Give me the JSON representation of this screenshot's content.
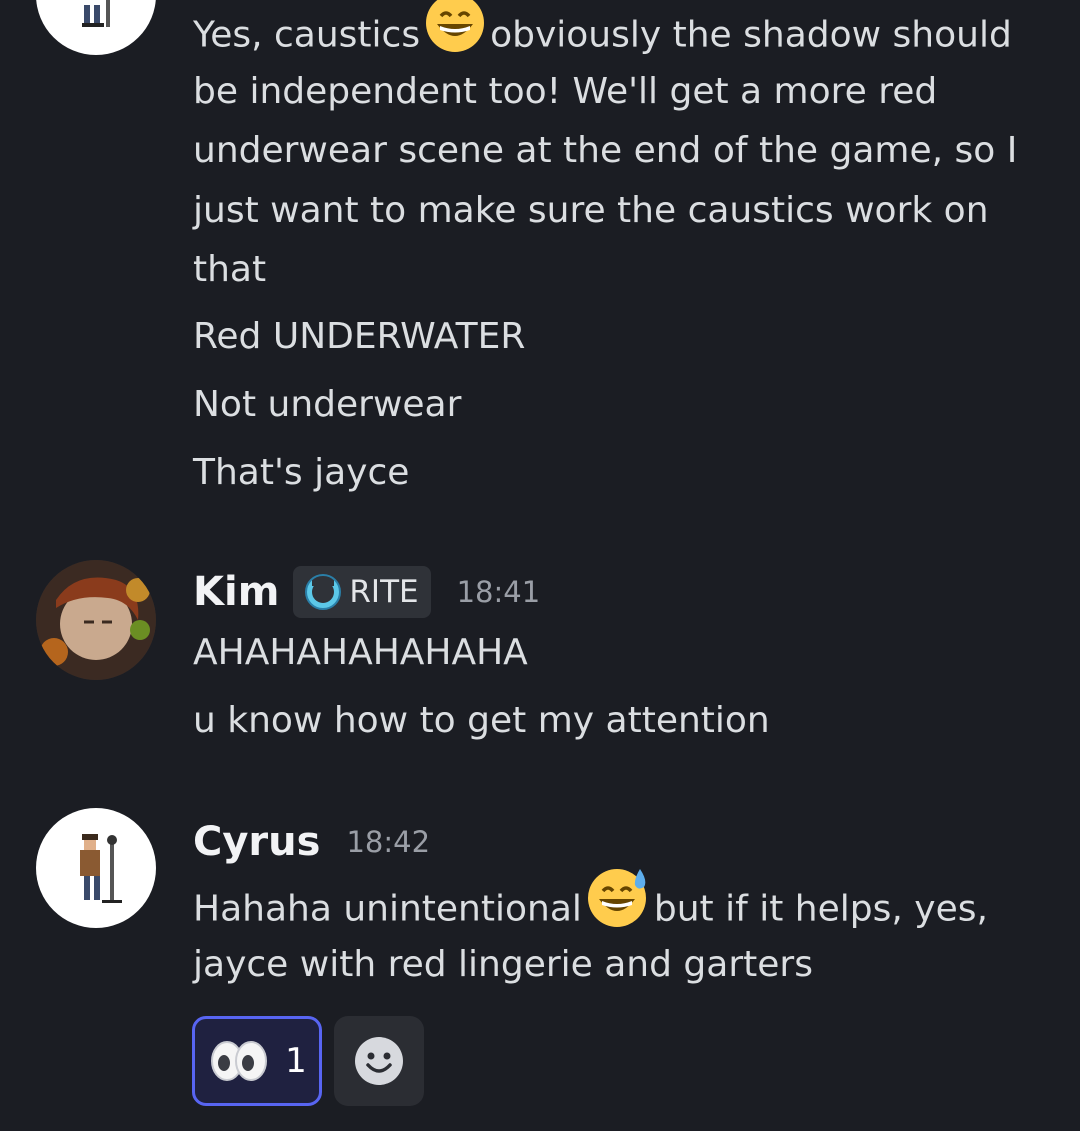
{
  "messages_top": {
    "lines": [
      "Yes, caustics",
      "obviously the shadow should",
      "be independent too! We'll get a more red",
      "underwear scene at the end of the game, so I",
      "just want to make sure the caustics work on",
      "that",
      "Red UNDERWATER",
      "Not underwear",
      "That's jayce"
    ],
    "emoji": "grinning-face-with-smiling-eyes"
  },
  "kim": {
    "username": "Kim",
    "tag": "RITE",
    "tag_icon": "shield-ring-icon",
    "time": "18:41",
    "lines": [
      "AHAHAHAHAHAHA",
      "u know how to get my attention"
    ]
  },
  "cyrus": {
    "username": "Cyrus",
    "time": "18:42",
    "line1_start": "Hahaha unintentional",
    "line1_end": "but if it helps, yes,",
    "line2": "jayce with red lingerie and garters",
    "emoji": "grinning-face-with-sweat"
  },
  "reactions": [
    {
      "emoji": "eyes-icon",
      "count": "1",
      "active": true
    }
  ],
  "add_reaction_icon": "smiley-add-reaction-icon",
  "colors": {
    "background": "#1b1d23",
    "text": "#dbdee1",
    "timestamp": "#9a9ea6",
    "accent": "#5865f2"
  }
}
